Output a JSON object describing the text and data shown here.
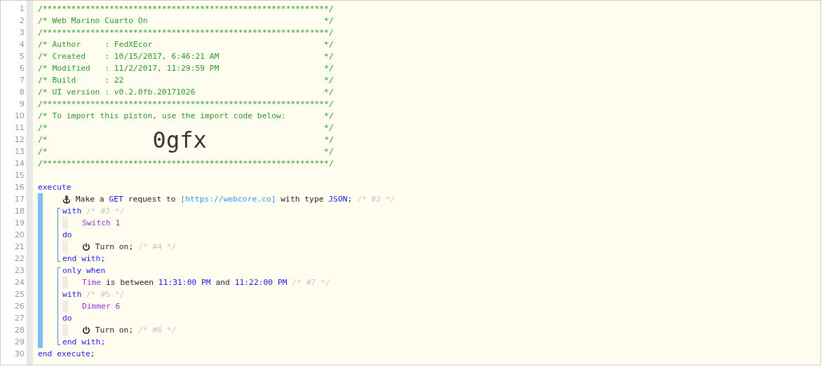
{
  "lines": [
    {
      "kind": "line",
      "number": "1",
      "tokens": [
        {
          "kind": "comment",
          "text": "/************************************************************/"
        }
      ]
    },
    {
      "kind": "line",
      "number": "2",
      "tokens": [
        {
          "kind": "comment",
          "text": "/* Web Marino Cuarto On                                     */"
        }
      ]
    },
    {
      "kind": "line",
      "number": "3",
      "tokens": [
        {
          "kind": "comment",
          "text": "/************************************************************/"
        }
      ]
    },
    {
      "kind": "line",
      "number": "4",
      "tokens": [
        {
          "kind": "comment",
          "text": "/* Author     : FedXEcor                                    */"
        }
      ]
    },
    {
      "kind": "line",
      "number": "5",
      "tokens": [
        {
          "kind": "comment",
          "text": "/* Created    : 10/15/2017, 6:46:21 AM                      */"
        }
      ]
    },
    {
      "kind": "line",
      "number": "6",
      "tokens": [
        {
          "kind": "comment",
          "text": "/* Modified   : 11/2/2017, 11:29:59 PM                      */"
        }
      ]
    },
    {
      "kind": "line",
      "number": "7",
      "tokens": [
        {
          "kind": "comment",
          "text": "/* Build      : 22                                          */"
        }
      ]
    },
    {
      "kind": "line",
      "number": "8",
      "tokens": [
        {
          "kind": "comment",
          "text": "/* UI version : v0.2.0fb.20171026                           */"
        }
      ]
    },
    {
      "kind": "line",
      "number": "9",
      "tokens": [
        {
          "kind": "comment",
          "text": "/************************************************************/"
        }
      ]
    },
    {
      "kind": "line",
      "number": "10",
      "tokens": [
        {
          "kind": "comment",
          "text": "/* To import this piston, use the import code below:        */"
        }
      ]
    },
    {
      "kind": "line",
      "number": "11",
      "tokens": [
        {
          "kind": "comment",
          "text": "/*                                                          */"
        }
      ]
    },
    {
      "kind": "line",
      "number": "12",
      "tokens": [
        {
          "kind": "comment",
          "text": "/*"
        },
        {
          "kind": "code",
          "text": "0gfx"
        },
        {
          "kind": "comment",
          "text": "*/"
        }
      ]
    },
    {
      "kind": "line",
      "number": "13",
      "tokens": [
        {
          "kind": "comment",
          "text": "/*                                                          */"
        }
      ]
    },
    {
      "kind": "line",
      "number": "14",
      "tokens": [
        {
          "kind": "comment",
          "text": "/************************************************************/"
        }
      ]
    },
    {
      "kind": "line",
      "number": "15"
    },
    {
      "kind": "block",
      "number": "16",
      "tokens": [
        {
          "kind": "keyword",
          "text": "execute"
        }
      ],
      "children": [
        {
          "kind": "line",
          "number": "17",
          "tokens": [
            {
              "kind": "anchor"
            },
            {
              "kind": "text",
              "text": " Make a "
            },
            {
              "kind": "keyword",
              "text": "GET"
            },
            {
              "kind": "text",
              "text": " request to "
            },
            {
              "kind": "link",
              "text": "[https://webcore.co]"
            },
            {
              "kind": "text",
              "text": " with type "
            },
            {
              "kind": "keyword",
              "text": "JSON"
            },
            {
              "kind": "text",
              "text": "; "
            },
            {
              "kind": "note",
              "text": "/* #2 */"
            }
          ]
        },
        {
          "kind": "group",
          "children": [
            {
              "kind": "clause",
              "number": "18",
              "tokens": [
                {
                  "kind": "keyword",
                  "text": "with "
                },
                {
                  "kind": "note",
                  "text": "/* #3 */"
                }
              ],
              "children": [
                {
                  "kind": "line",
                  "number": "19",
                  "tokens": [
                    {
                      "kind": "device",
                      "text": "Switch 1"
                    }
                  ]
                }
              ]
            },
            {
              "kind": "clause",
              "number": "20",
              "tokens": [
                {
                  "kind": "keyword",
                  "text": "do"
                }
              ],
              "children": [
                {
                  "kind": "line",
                  "number": "21",
                  "tokens": [
                    {
                      "kind": "power"
                    },
                    {
                      "kind": "text",
                      "text": " Turn on; "
                    },
                    {
                      "kind": "note",
                      "text": "/* #4 */"
                    }
                  ]
                }
              ]
            },
            {
              "kind": "line",
              "number": "22",
              "tokens": [
                {
                  "kind": "keyword",
                  "text": "end with;"
                }
              ]
            }
          ]
        },
        {
          "kind": "group",
          "children": [
            {
              "kind": "clause",
              "number": "23",
              "tokens": [
                {
                  "kind": "keyword",
                  "text": "only when"
                }
              ],
              "children": [
                {
                  "kind": "line",
                  "number": "24",
                  "tokens": [
                    {
                      "kind": "device",
                      "text": "Time"
                    },
                    {
                      "kind": "text",
                      "text": " is between "
                    },
                    {
                      "kind": "value",
                      "text": "11:31:00 PM"
                    },
                    {
                      "kind": "text",
                      "text": " and "
                    },
                    {
                      "kind": "value",
                      "text": "11:22:00 PM"
                    },
                    {
                      "kind": "note",
                      "text": " /* #7 */"
                    }
                  ]
                }
              ]
            },
            {
              "kind": "clause",
              "number": "25",
              "tokens": [
                {
                  "kind": "keyword",
                  "text": "with "
                },
                {
                  "kind": "note",
                  "text": "/* #5 */"
                }
              ],
              "children": [
                {
                  "kind": "line",
                  "number": "26",
                  "tokens": [
                    {
                      "kind": "device",
                      "text": "Dimmer 6"
                    }
                  ]
                }
              ]
            },
            {
              "kind": "clause",
              "number": "27",
              "tokens": [
                {
                  "kind": "keyword",
                  "text": "do"
                }
              ],
              "children": [
                {
                  "kind": "line",
                  "number": "28",
                  "tokens": [
                    {
                      "kind": "power"
                    },
                    {
                      "kind": "text",
                      "text": " Turn on; "
                    },
                    {
                      "kind": "note",
                      "text": "/* #6 */"
                    }
                  ]
                }
              ]
            },
            {
              "kind": "line",
              "number": "29",
              "tokens": [
                {
                  "kind": "keyword",
                  "text": "end with;"
                }
              ]
            }
          ]
        }
      ]
    },
    {
      "kind": "line",
      "number": "30",
      "tokens": [
        {
          "kind": "keyword",
          "text": "end execute;"
        }
      ]
    }
  ]
}
